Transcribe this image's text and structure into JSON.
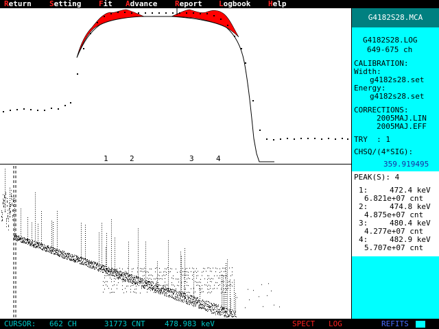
{
  "menu": {
    "items": [
      {
        "hot": "R",
        "rest": "eturn"
      },
      {
        "hot": "S",
        "rest": "etting"
      },
      {
        "hot": "F",
        "rest": "it"
      },
      {
        "hot": "A",
        "rest": "dvance"
      },
      {
        "hot": "R",
        "rest": "eport"
      },
      {
        "hot": "L",
        "rest": "ogbook"
      },
      {
        "hot": "H",
        "rest": "elp"
      }
    ]
  },
  "sidebar": {
    "title": "G4182S28.MCA",
    "log_file": "G4182S28.LOG",
    "channel_range": "649-675 ch",
    "calibration_label": "CALIBRATION:",
    "width_label": "Width:",
    "width_file": "g4182s28.set",
    "energy_label": "Energy:",
    "energy_file": "g4182s28.set",
    "corrections_label": "CORRECTIONS:",
    "correction_lin": "2005MAJ.LIN",
    "correction_eff": "2005MAJ.EFF",
    "try_label": "TRY  : 1",
    "chisq_label": "CHSQ/(4*SIG):",
    "chisq_value": "359.919495",
    "peaks_label": "PEAK(S): 4",
    "peaks": [
      {
        "idx": "1:",
        "energy": "472.4 keV",
        "counts": "6.821e+07 cnt"
      },
      {
        "idx": "2:",
        "energy": "474.8 keV",
        "counts": "4.875e+07 cnt"
      },
      {
        "idx": "3:",
        "energy": "480.4 keV",
        "counts": "4.277e+07 cnt"
      },
      {
        "idx": "4:",
        "energy": "482.9 keV",
        "counts": "5.707e+07 cnt"
      }
    ]
  },
  "fit_plot": {
    "peak_markers": [
      "1",
      "2",
      "3",
      "4"
    ]
  },
  "status": {
    "cursor_label": "CURSOR:",
    "cursor_channel": "662 CH",
    "counts": "31773 CNT",
    "energy": "478.983 keV",
    "spect": "SPECT",
    "log": "LOG",
    "refits": "REFITS"
  },
  "colors": {
    "menu_hotkey": "#ff2020",
    "fit_fill": "#ff0000",
    "sidebar_bg": "#00ffff",
    "sidebar_header": "#008080",
    "status_cyan": "#00c8c8",
    "status_blue": "#4a6cff"
  },
  "icons": {
    "text_cursor": "block-cursor"
  }
}
